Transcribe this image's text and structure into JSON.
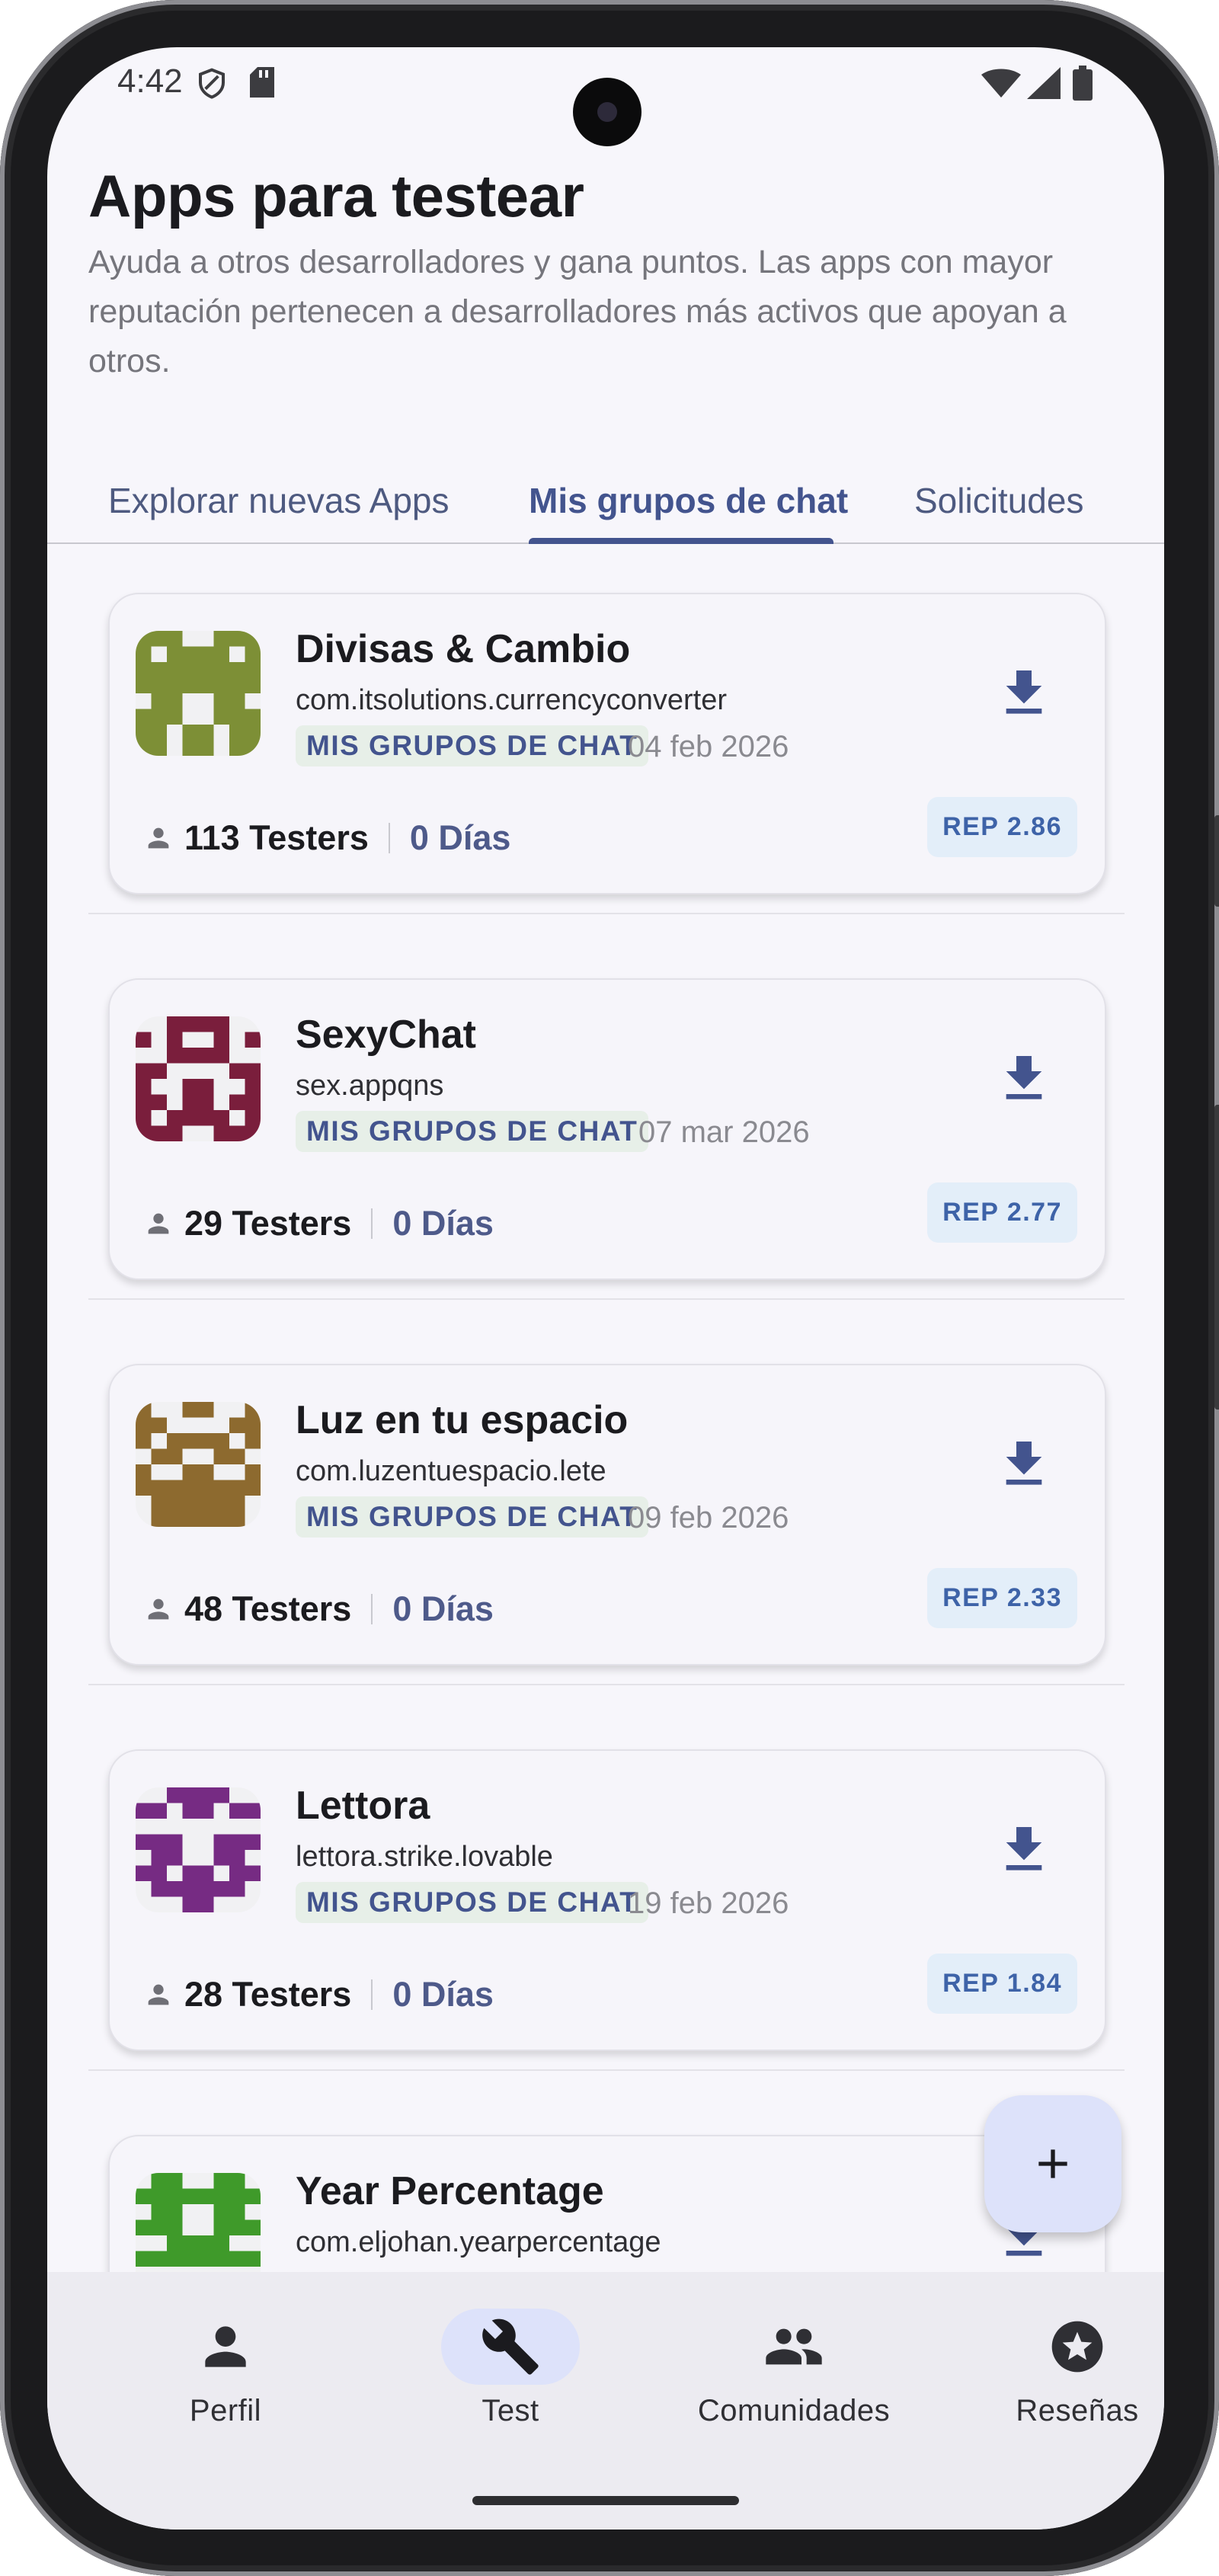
{
  "status_bar": {
    "time": "4:42"
  },
  "header": {
    "title": "Apps para testear",
    "subtitle": "Ayuda a otros desarrolladores y gana puntos. Las apps con mayor reputación pertenecen a desarrolladores más activos que apoyan a otros."
  },
  "tabs": [
    {
      "label": "Explorar nuevas Apps"
    },
    {
      "label": "Mis grupos de chat"
    },
    {
      "label": "Solicitudes"
    }
  ],
  "apps": [
    {
      "name": "Divisas & Cambio",
      "package": "com.itsolutions.currencyconverter",
      "badge": "MIS GRUPOS DE CHAT",
      "date": "04 feb 2026",
      "testers": "113 Testers",
      "days": "0 Días",
      "rep": "REP 2.86",
      "icon_color": "#7d8f36"
    },
    {
      "name": "SexyChat",
      "package": "sex.appqns",
      "badge": "MIS GRUPOS DE CHAT",
      "date": "07 mar 2026",
      "testers": "29 Testers",
      "days": "0 Días",
      "rep": "REP 2.77",
      "icon_color": "#7a1e3c"
    },
    {
      "name": "Luz en tu espacio",
      "package": "com.luzentuespacio.lete",
      "badge": "MIS GRUPOS DE CHAT",
      "date": "09 feb 2026",
      "testers": "48 Testers",
      "days": "0 Días",
      "rep": "REP 2.33",
      "icon_color": "#8d6a2f"
    },
    {
      "name": "Lettora",
      "package": "lettora.strike.lovable",
      "badge": "MIS GRUPOS DE CHAT",
      "date": "19 feb 2026",
      "testers": "28 Testers",
      "days": "0 Días",
      "rep": "REP 1.84",
      "icon_color": "#762b83"
    },
    {
      "name": "Year Percentage",
      "package": "com.eljohan.yearpercentage",
      "icon_color": "#3f9a2a"
    }
  ],
  "fab": {
    "icon": "plus-icon"
  },
  "bottom_nav": [
    {
      "label": "Perfil",
      "icon": "person-icon"
    },
    {
      "label": "Test",
      "icon": "wrench-icon",
      "active": true
    },
    {
      "label": "Comunidades",
      "icon": "group-icon"
    },
    {
      "label": "Reseñas",
      "icon": "star-badge-icon"
    }
  ],
  "colors": {
    "primary": "#43548e",
    "background": "#f7f6fb",
    "active_pill": "#dde2fa"
  }
}
